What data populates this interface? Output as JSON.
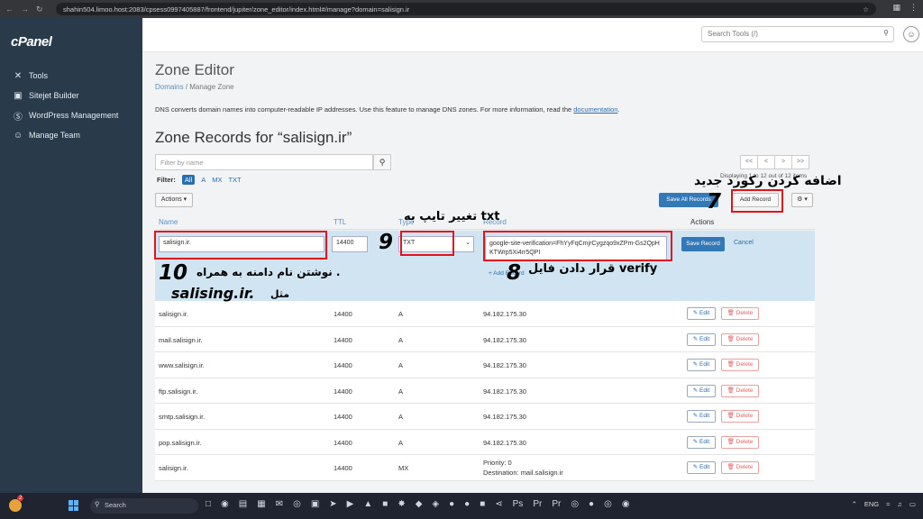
{
  "browser": {
    "url": "shahin504.limoo.host:2083/cpsess0997405887/frontend/jupiter/zone_editor/index.html#/manage?domain=salisign.ir"
  },
  "sidebar": {
    "logo": "cPanel",
    "items": [
      {
        "label": "Tools",
        "icon": "tools-icon"
      },
      {
        "label": "Sitejet Builder",
        "icon": "sitejet-icon"
      },
      {
        "label": "WordPress Management",
        "icon": "wordpress-icon"
      },
      {
        "label": "Manage Team",
        "icon": "team-icon"
      }
    ]
  },
  "header": {
    "search_placeholder": "Search Tools (/)"
  },
  "page": {
    "title": "Zone Editor",
    "breadcrumb": [
      "Domains",
      "Manage Zone"
    ],
    "description": "DNS converts domain names into computer-readable IP addresses. Use this feature to manage DNS zones. For more information, read the ",
    "description_link": "documentation",
    "zone_title": "Zone Records for “salisign.ir”",
    "filter_placeholder": "Filter by name",
    "filter_label": "Filter:",
    "filter_tabs": [
      "All",
      "A",
      "MX",
      "TXT"
    ],
    "pager": [
      "<<",
      "<",
      ">",
      ">>"
    ],
    "displaying": "Displaying 1 to 12 out of 12 items",
    "actions_label": "Actions ▾",
    "save_all_label": "Save All Records",
    "add_record_label": "Add Record",
    "gear_label": "⚙ ▾"
  },
  "table": {
    "headers": {
      "name": "Name",
      "ttl": "TTL",
      "type": "Type",
      "record": "Record",
      "actions": "Actions"
    },
    "edit_row": {
      "name": "salisign.ir.",
      "ttl": "14400",
      "type": "TXT",
      "record": "google-site-verification=FhYyFqCmjrCygzqo9xZPm-Gs2QpHKTWrp5Xi4rr5QPI",
      "save": "Save Record",
      "cancel": "Cancel",
      "add_record": "+ Add Record"
    },
    "rows": [
      {
        "name": "salisign.ir.",
        "ttl": "14400",
        "type": "A",
        "record": "94.182.175.30",
        "record2": ""
      },
      {
        "name": "mail.salisign.ir.",
        "ttl": "14400",
        "type": "A",
        "record": "94.182.175.30",
        "record2": ""
      },
      {
        "name": "www.salisign.ir.",
        "ttl": "14400",
        "type": "A",
        "record": "94.182.175.30",
        "record2": ""
      },
      {
        "name": "ftp.salisign.ir.",
        "ttl": "14400",
        "type": "A",
        "record": "94.182.175.30",
        "record2": ""
      },
      {
        "name": "smtp.salisign.ir.",
        "ttl": "14400",
        "type": "A",
        "record": "94.182.175.30",
        "record2": ""
      },
      {
        "name": "pop.salisign.ir.",
        "ttl": "14400",
        "type": "A",
        "record": "94.182.175.30",
        "record2": ""
      },
      {
        "name": "salisign.ir.",
        "ttl": "14400",
        "type": "MX",
        "record": "Priority: 0",
        "record2": "Destination: mail.salisign.ir"
      }
    ],
    "edit_label": "✎ Edit",
    "delete_label": "🗑 Delete"
  },
  "annotations": {
    "step7_text": "اضافه کردن رکورد جدید",
    "step7_num": "7",
    "step9_text": "تغییر تایپ به txt",
    "step9_num": "9",
    "step8_text": "قرار دادن فایل verify",
    "step8_num": "8",
    "step10_num": "10",
    "step10_text": "نوشتن نام دامنه به همراه .",
    "step10_example": "salising.ir.",
    "step10_suffix": "مثل"
  },
  "taskbar": {
    "search": "Search",
    "lang": "ENG",
    "time": "",
    "badge": "2"
  },
  "colors": {
    "sidebar": "#293a4a",
    "primary": "#3479b7",
    "annotation_red": "#e0141a"
  }
}
